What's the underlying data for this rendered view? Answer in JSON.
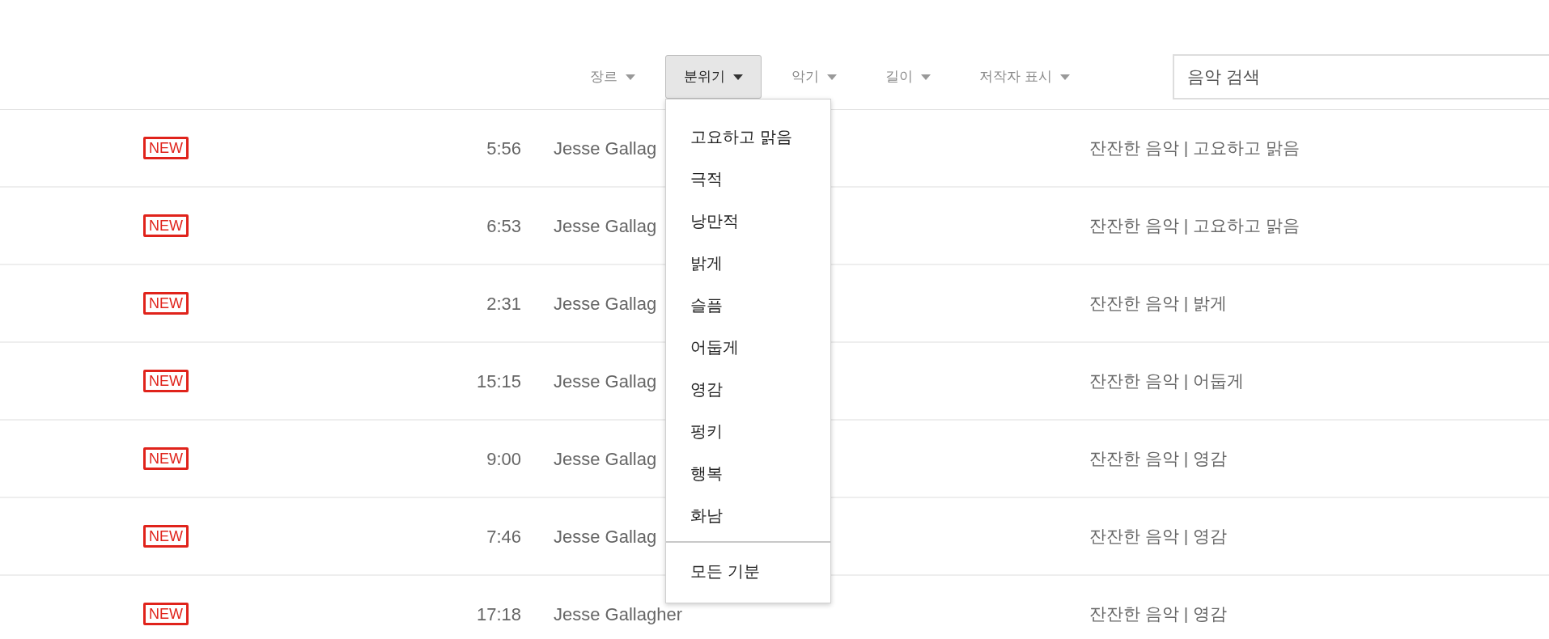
{
  "filters": [
    {
      "label": "장르",
      "selected": false
    },
    {
      "label": "분위기",
      "selected": true
    },
    {
      "label": "악기",
      "selected": false
    },
    {
      "label": "길이",
      "selected": false
    },
    {
      "label": "저작자 표시",
      "selected": false
    }
  ],
  "search": {
    "placeholder": "음악 검색"
  },
  "mood_menu": {
    "items": [
      "고요하고 맑음",
      "극적",
      "낭만적",
      "밝게",
      "슬픔",
      "어둡게",
      "영감",
      "펑키",
      "행복",
      "화남"
    ],
    "footer_items": [
      "모든 기분"
    ]
  },
  "tracks": [
    {
      "badge": "NEW",
      "duration": "5:56",
      "artist": "Jesse Gallag",
      "tags": "잔잔한 음악 | 고요하고 맑음"
    },
    {
      "badge": "NEW",
      "duration": "6:53",
      "artist": "Jesse Gallag",
      "tags": "잔잔한 음악 | 고요하고 맑음"
    },
    {
      "badge": "NEW",
      "duration": "2:31",
      "artist": "Jesse Gallag",
      "tags": "잔잔한 음악 | 밝게"
    },
    {
      "badge": "NEW",
      "duration": "15:15",
      "artist": "Jesse Gallag",
      "tags": "잔잔한 음악 | 어둡게"
    },
    {
      "badge": "NEW",
      "duration": "9:00",
      "artist": "Jesse Gallag",
      "tags": "잔잔한 음악 | 영감"
    },
    {
      "badge": "NEW",
      "duration": "7:46",
      "artist": "Jesse Gallag",
      "tags": "잔잔한 음악 | 영감"
    },
    {
      "badge": "NEW",
      "duration": "17:18",
      "artist": "Jesse Gallagher",
      "tags": "잔잔한 음악 | 영감"
    }
  ]
}
